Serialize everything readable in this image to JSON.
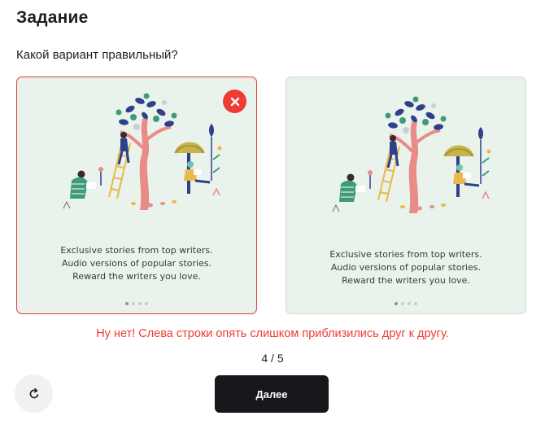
{
  "header": {
    "title": "Задание",
    "question": "Какой вариант правильный?"
  },
  "options": [
    {
      "lines": [
        "Exclusive stories from top writers.",
        "Audio versions of popular stories.",
        "Reward the writers you love."
      ],
      "state": "wrong",
      "carousel_active_dot": 1,
      "carousel_dot_count": 4
    },
    {
      "lines": [
        "Exclusive stories from top writers.",
        "Audio versions of popular stories.",
        "Reward the writers you love."
      ],
      "state": "unselected",
      "carousel_active_dot": 1,
      "carousel_dot_count": 4
    }
  ],
  "feedback": "Ну нет! Слева строки опять слишком приблизились друг к другу.",
  "progress": {
    "text": "4 / 5",
    "current": 4,
    "total": 5
  },
  "actions": {
    "next_label": "Далее",
    "reload_icon": "reload-icon",
    "wrong_icon": "close-icon"
  },
  "colors": {
    "error": "#ef3b35",
    "card_bg": "#e9f3ec",
    "button_bg": "#17181c"
  }
}
